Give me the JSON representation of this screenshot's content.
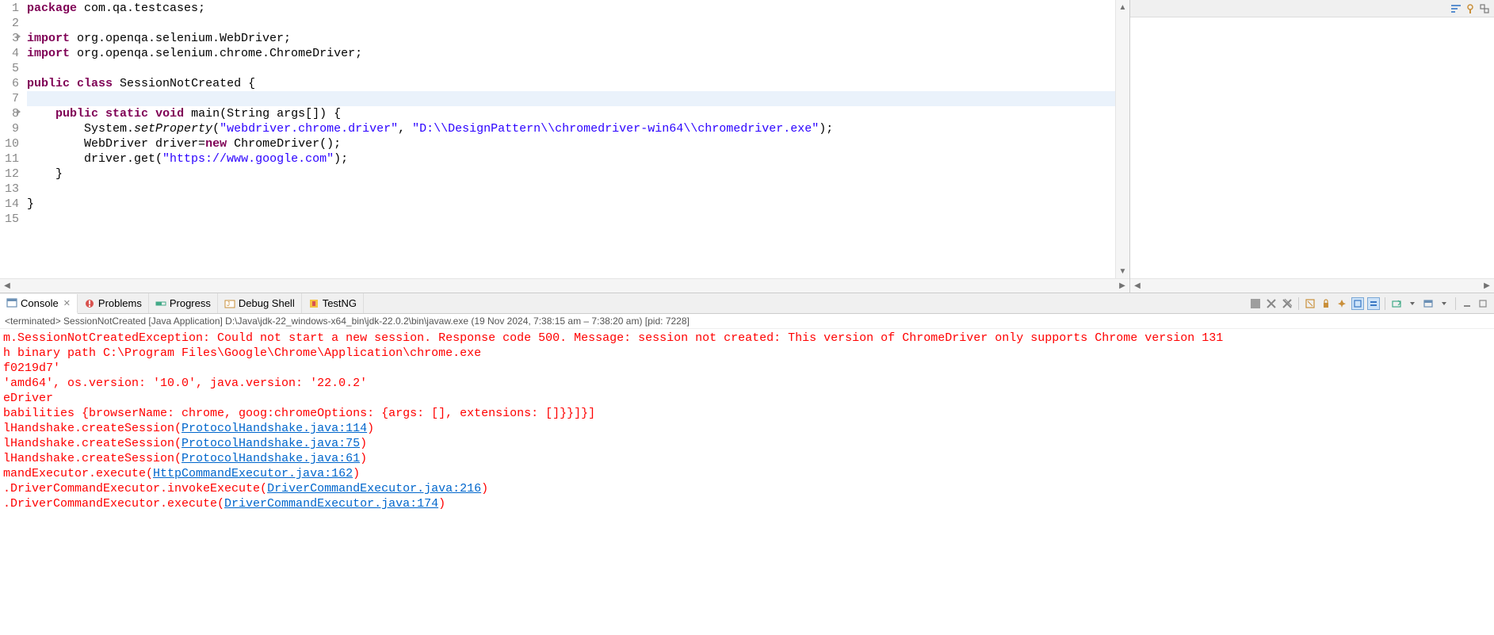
{
  "editor": {
    "lines": [
      {
        "n": "1",
        "marker": false,
        "segs": [
          {
            "t": "package",
            "c": "kw"
          },
          {
            "t": " com.qa.testcases;"
          }
        ]
      },
      {
        "n": "2",
        "marker": false,
        "segs": []
      },
      {
        "n": "3",
        "marker": true,
        "segs": [
          {
            "t": "import",
            "c": "kw"
          },
          {
            "t": " org.openqa.selenium.WebDriver;"
          }
        ]
      },
      {
        "n": "4",
        "marker": false,
        "segs": [
          {
            "t": "import",
            "c": "kw"
          },
          {
            "t": " org.openqa.selenium.chrome.ChromeDriver;"
          }
        ]
      },
      {
        "n": "5",
        "marker": false,
        "segs": []
      },
      {
        "n": "6",
        "marker": false,
        "segs": [
          {
            "t": "public",
            "c": "kw"
          },
          {
            "t": " "
          },
          {
            "t": "class",
            "c": "kw"
          },
          {
            "t": " SessionNotCreated {"
          }
        ]
      },
      {
        "n": "7",
        "marker": false,
        "hl": true,
        "segs": []
      },
      {
        "n": "8",
        "marker": true,
        "segs": [
          {
            "t": "    "
          },
          {
            "t": "public",
            "c": "kw"
          },
          {
            "t": " "
          },
          {
            "t": "static",
            "c": "kw"
          },
          {
            "t": " "
          },
          {
            "t": "void",
            "c": "kw"
          },
          {
            "t": " main(String args[]) {"
          }
        ]
      },
      {
        "n": "9",
        "marker": false,
        "segs": [
          {
            "t": "        System."
          },
          {
            "t": "setProperty",
            "c": "italic"
          },
          {
            "t": "("
          },
          {
            "t": "\"webdriver.chrome.driver\"",
            "c": "str"
          },
          {
            "t": ", "
          },
          {
            "t": "\"D:\\\\DesignPattern\\\\chromedriver-win64\\\\chromedriver.exe\"",
            "c": "str"
          },
          {
            "t": ");"
          }
        ]
      },
      {
        "n": "10",
        "marker": false,
        "segs": [
          {
            "t": "        WebDriver "
          },
          {
            "t": "driver"
          },
          {
            "t": "="
          },
          {
            "t": "new",
            "c": "kw"
          },
          {
            "t": " ChromeDriver();"
          }
        ]
      },
      {
        "n": "11",
        "marker": false,
        "segs": [
          {
            "t": "        "
          },
          {
            "t": "driver"
          },
          {
            "t": ".get("
          },
          {
            "t": "\"https://www.google.com\"",
            "c": "str"
          },
          {
            "t": ");"
          }
        ]
      },
      {
        "n": "12",
        "marker": false,
        "segs": [
          {
            "t": "    }"
          }
        ]
      },
      {
        "n": "13",
        "marker": false,
        "segs": []
      },
      {
        "n": "14",
        "marker": false,
        "segs": [
          {
            "t": "}"
          }
        ]
      },
      {
        "n": "15",
        "marker": false,
        "segs": []
      }
    ]
  },
  "tabs": {
    "console": "Console",
    "problems": "Problems",
    "progress": "Progress",
    "debugshell": "Debug Shell",
    "testng": "TestNG"
  },
  "console": {
    "header": "<terminated> SessionNotCreated [Java Application] D:\\Java\\jdk-22_windows-x64_bin\\jdk-22.0.2\\bin\\javaw.exe  (19 Nov 2024, 7:38:15 am – 7:38:20 am) [pid: 7228]",
    "rows": [
      {
        "segs": [
          {
            "t": "m.SessionNotCreatedException",
            "c": "err"
          },
          {
            "t": ": Could not start a new session. Response code 500. Message: session not created: This version of ChromeDriver only supports Chrome version 131",
            "c": "err"
          }
        ]
      },
      {
        "segs": [
          {
            "t": "h binary path C:\\Program Files\\Google\\Chrome\\Application\\chrome.exe",
            "c": "err"
          }
        ]
      },
      {
        "segs": [
          {
            "t": ""
          }
        ]
      },
      {
        "segs": [
          {
            "t": "f0219d7'",
            "c": "err"
          }
        ]
      },
      {
        "segs": [
          {
            "t": "'amd64', os.version: '10.0', java.version: '22.0.2'",
            "c": "err"
          }
        ]
      },
      {
        "segs": [
          {
            "t": "eDriver",
            "c": "err"
          }
        ]
      },
      {
        "segs": [
          {
            "t": "babilities {browserName: chrome, goog:chromeOptions: {args: [], extensions: []}}]}]",
            "c": "err"
          }
        ]
      },
      {
        "segs": [
          {
            "t": "lHandshake.createSession(",
            "c": "err"
          },
          {
            "t": "ProtocolHandshake.java:114",
            "c": "lnk"
          },
          {
            "t": ")",
            "c": "err"
          }
        ]
      },
      {
        "segs": [
          {
            "t": "lHandshake.createSession(",
            "c": "err"
          },
          {
            "t": "ProtocolHandshake.java:75",
            "c": "lnk"
          },
          {
            "t": ")",
            "c": "err"
          }
        ]
      },
      {
        "segs": [
          {
            "t": "lHandshake.createSession(",
            "c": "err"
          },
          {
            "t": "ProtocolHandshake.java:61",
            "c": "lnk"
          },
          {
            "t": ")",
            "c": "err"
          }
        ]
      },
      {
        "segs": [
          {
            "t": "mandExecutor.execute(",
            "c": "err"
          },
          {
            "t": "HttpCommandExecutor.java:162",
            "c": "lnk"
          },
          {
            "t": ")",
            "c": "err"
          }
        ]
      },
      {
        "segs": [
          {
            "t": ".DriverCommandExecutor.invokeExecute(",
            "c": "err"
          },
          {
            "t": "DriverCommandExecutor.java:216",
            "c": "lnk"
          },
          {
            "t": ")",
            "c": "err"
          }
        ]
      },
      {
        "segs": [
          {
            "t": ".DriverCommandExecutor.execute(",
            "c": "err"
          },
          {
            "t": "DriverCommandExecutor.java:174",
            "c": "lnk"
          },
          {
            "t": ")",
            "c": "err"
          }
        ]
      }
    ]
  },
  "side_icons": {
    "a": "outline-collapse",
    "b": "outline-expand",
    "c": "outline-link"
  }
}
